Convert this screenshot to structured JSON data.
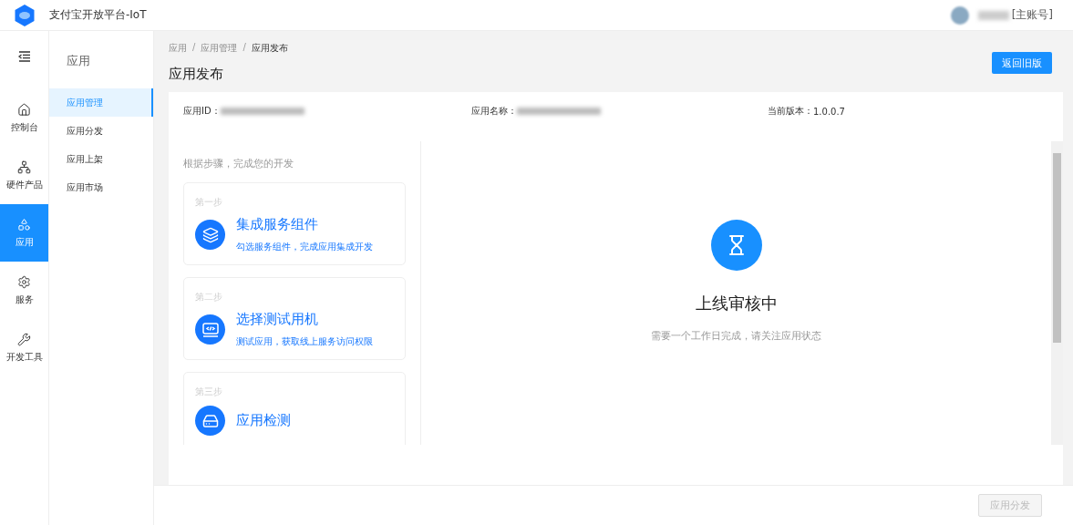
{
  "header": {
    "title": "支付宝开放平台-IoT",
    "account_tag": "[主账号]"
  },
  "rail": [
    {
      "kind": "home",
      "label": "控制台",
      "selected": false
    },
    {
      "kind": "hardware",
      "label": "硬件产品",
      "selected": false
    },
    {
      "kind": "apps",
      "label": "应用",
      "selected": true
    },
    {
      "kind": "service",
      "label": "服务",
      "selected": false
    },
    {
      "kind": "tools",
      "label": "开发工具",
      "selected": false
    }
  ],
  "submenu": {
    "title": "应用",
    "items": [
      {
        "label": "应用管理",
        "selected": true
      },
      {
        "label": "应用分发",
        "selected": false
      },
      {
        "label": "应用上架",
        "selected": false
      },
      {
        "label": "应用市场",
        "selected": false
      }
    ]
  },
  "breadcrumb": [
    "应用",
    "应用管理",
    "应用发布"
  ],
  "breadcrumb_separator": "/",
  "page_title": "应用发布",
  "back_button": "返回旧版",
  "info": [
    {
      "label": "应用ID："
    },
    {
      "label": "应用名称："
    },
    {
      "label": "当前版本：",
      "value": "1.0.0.7"
    }
  ],
  "steps_heading": "根据步骤，完成您的开发",
  "steps": [
    {
      "kind": "layers",
      "step": "第一步",
      "title": "集成服务组件",
      "description": "勾选服务组件，完成应用集成开发"
    },
    {
      "kind": "code",
      "step": "第二步",
      "title": "选择测试用机",
      "description": "测试应用，获取线上服务访问权限"
    },
    {
      "kind": "drive",
      "step": "第三步",
      "title": "应用检测"
    }
  ],
  "status": {
    "title": "上线审核中",
    "description": "需要一个工作日完成，请关注应用状态"
  },
  "footer_button": {
    "label": "应用分发",
    "disabled": true
  }
}
